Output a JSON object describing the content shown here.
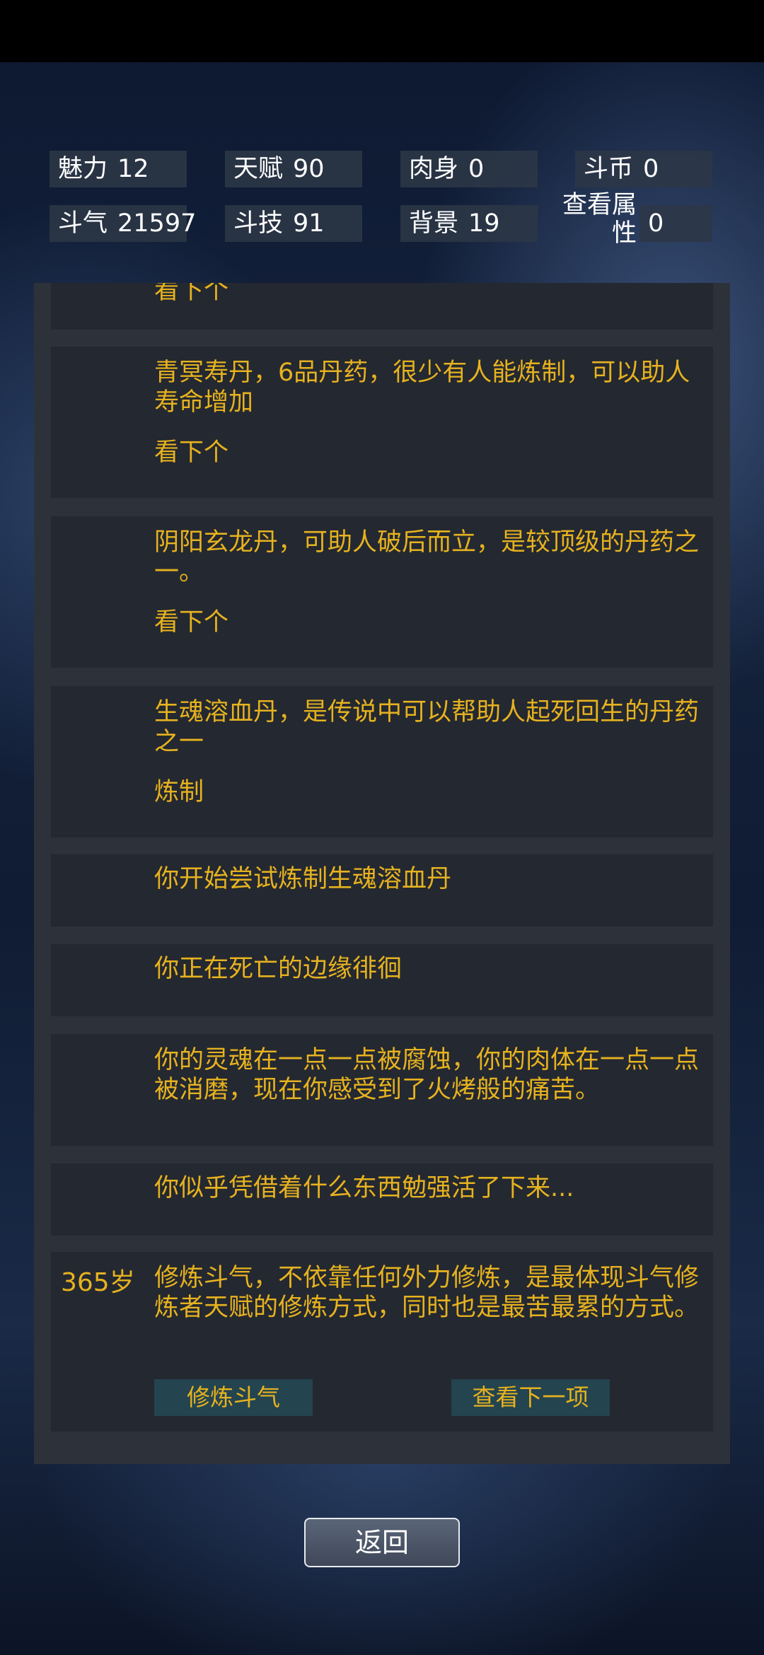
{
  "stats": [
    {
      "label": "魅力",
      "value": "12"
    },
    {
      "label": "天赋",
      "value": "90"
    },
    {
      "label": "肉身",
      "value": "0"
    },
    {
      "label": "斗币",
      "value": "0"
    },
    {
      "label": "斗气",
      "value": "21597"
    },
    {
      "label": "斗技",
      "value": "91"
    },
    {
      "label": "背景",
      "value": "19"
    },
    {
      "label": "查看属性",
      "value": "0"
    }
  ],
  "view_attr_label_line1": "查看属",
  "view_attr_label_line2": "性",
  "log": {
    "entry0": {
      "action": "看下个"
    },
    "entry1": {
      "text": "青冥寿丹，6品丹药，很少有人能炼制，可以助人寿命增加",
      "action": "看下个"
    },
    "entry2": {
      "text": "阴阳玄龙丹，可助人破后而立，是较顶级的丹药之一。",
      "action": "看下个"
    },
    "entry3": {
      "text": "生魂溶血丹，是传说中可以帮助人起死回生的丹药之一",
      "action": "炼制"
    },
    "entry4": {
      "text": "你开始尝试炼制生魂溶血丹"
    },
    "entry5": {
      "text": "你正在死亡的边缘徘徊"
    },
    "entry6": {
      "text": "你的灵魂在一点一点被腐蚀，你的肉体在一点一点被消磨，现在你感受到了火烤般的痛苦。"
    },
    "entry7": {
      "text": "你似乎凭借着什么东西勉强活了下来..."
    },
    "entry8": {
      "age": "365岁",
      "text": "修炼斗气，不依靠任何外力修炼，是最体现斗气修炼者天赋的修炼方式，同时也是最苦最累的方式。",
      "button1": "修炼斗气",
      "button2": "查看下一项"
    }
  },
  "back_label": "返回",
  "colors": {
    "accent": "#e6b21f",
    "card_bg": "#242830",
    "panel_bg": "#2d323a",
    "button_bg": "#24444f"
  }
}
